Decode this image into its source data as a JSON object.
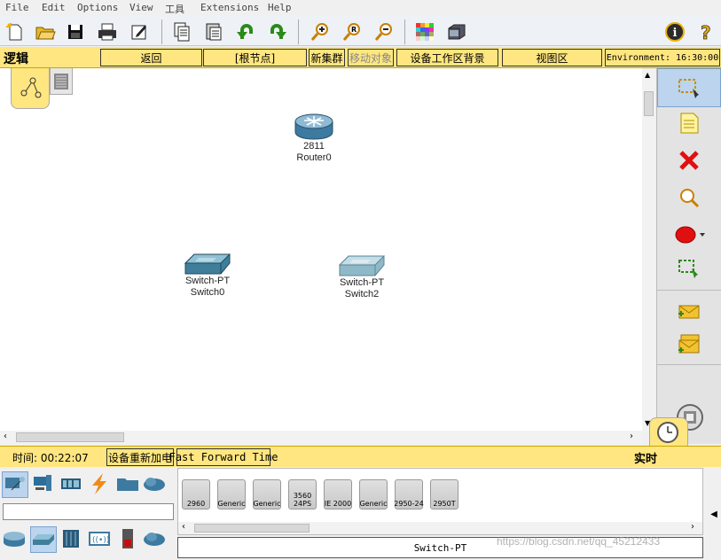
{
  "menu": [
    "File",
    "Edit",
    "Options",
    "View",
    "工具",
    "Extensions",
    "Help"
  ],
  "nav": {
    "mode_label": "逻辑",
    "back": "返回",
    "root": "[根节点]",
    "new_cluster": "新集群",
    "move_object": "移动对象",
    "set_background": "设备工作区背景",
    "viewport": "视图区",
    "environment": "Environment: 16:30:00"
  },
  "canvas": {
    "nodes": [
      {
        "model": "2811",
        "name": "Router0"
      },
      {
        "model": "Switch-PT",
        "name": "Switch0"
      },
      {
        "model": "Switch-PT",
        "name": "Switch2"
      }
    ]
  },
  "status": {
    "time": "时间: 00:22:07",
    "power_cycle": "设备重新加电",
    "fast_forward": "Fast Forward Time",
    "realtime": "实时"
  },
  "device_panel": {
    "search_value": "",
    "selected_type": "Switch-PT",
    "models": [
      "2960",
      "Generic",
      "Generic",
      "3560\n24PS",
      "IE 2000",
      "Generic",
      "2950-24",
      "2950T"
    ]
  },
  "watermark": "https://blog.csdn.net/qq_45212433",
  "colors": {
    "nav_bg": "#ffe680",
    "canvas_bg": "#ffffff",
    "accent": "#3a7fc1"
  }
}
